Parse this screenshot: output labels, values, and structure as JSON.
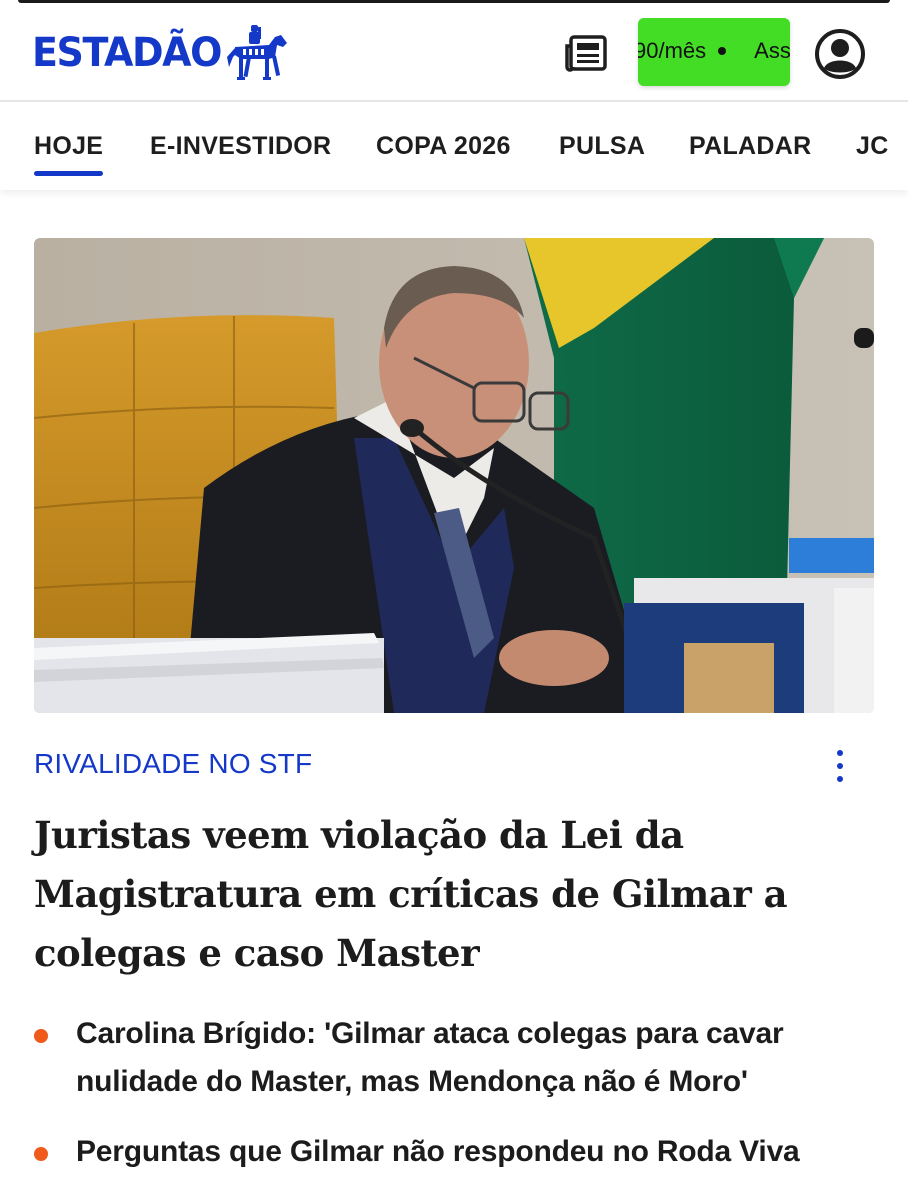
{
  "header": {
    "logo_text": "ESTADÃO",
    "subscribe_price": "90/mês",
    "subscribe_cta": "Ass",
    "colors": {
      "brand_blue": "#1438c8",
      "subscribe_green": "#43dd25"
    },
    "icons": [
      "newspaper-icon",
      "horse-rider-logo-icon",
      "user-avatar-icon"
    ]
  },
  "nav": {
    "tabs": [
      {
        "label": "HOJE",
        "active": true
      },
      {
        "label": "E-INVESTIDOR",
        "active": false
      },
      {
        "label": "COPA 2026",
        "active": false
      },
      {
        "label": "PULSA",
        "active": false
      },
      {
        "label": "PALADAR",
        "active": false
      },
      {
        "label": "JC",
        "active": false
      }
    ]
  },
  "article": {
    "kicker": "RIVALIDADE NO STF",
    "headline": "Juristas veem violação da Lei da Magistratura em críticas de Gilmar a colegas e caso Master",
    "related": [
      {
        "text": "Carolina Brígido: 'Gilmar ataca colegas para cavar nulidade do Master, mas Mendonça não é Moro'"
      },
      {
        "text": "Perguntas que Gilmar não respondeu no Roda Viva"
      }
    ],
    "colors": {
      "kicker": "#1438c8",
      "bullet": "#f05a1a"
    }
  }
}
